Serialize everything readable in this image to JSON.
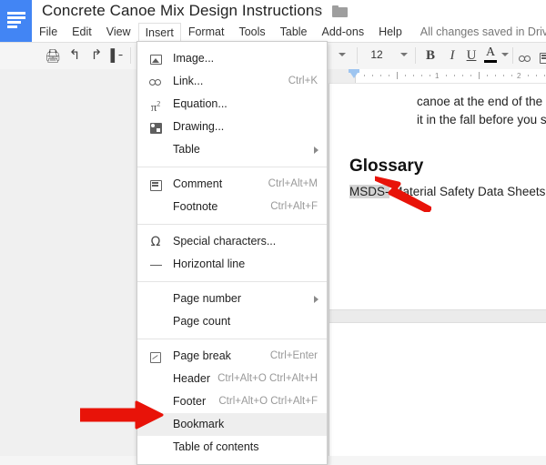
{
  "app": {
    "name": "Google Docs",
    "logo_icon": "docs-logo-icon",
    "accent_color": "#4285f4"
  },
  "header": {
    "doc_title": "Concrete Canoe Mix Design Instructions",
    "star_icon": "star-icon",
    "folder_icon": "folder-icon",
    "save_status": "All changes saved in Drive",
    "menus": [
      {
        "label": "File",
        "active": false
      },
      {
        "label": "Edit",
        "active": false
      },
      {
        "label": "View",
        "active": false
      },
      {
        "label": "Insert",
        "active": true
      },
      {
        "label": "Format",
        "active": false
      },
      {
        "label": "Tools",
        "active": false
      },
      {
        "label": "Table",
        "active": false
      },
      {
        "label": "Add-ons",
        "active": false
      },
      {
        "label": "Help",
        "active": false
      }
    ]
  },
  "toolbar": {
    "print_icon": "print-icon",
    "undo_icon": "undo-icon",
    "redo_icon": "redo-icon",
    "paint_format_icon": "paint-format-icon",
    "style_caret_icon": "chevron-down-icon",
    "font_size_value": "12",
    "font_size_caret_icon": "chevron-down-icon",
    "bold_label": "B",
    "italic_label": "I",
    "underline_label": "U",
    "text_color_label": "A",
    "text_color_swatch": "#000000",
    "text_color_caret_icon": "chevron-down-icon",
    "link_icon": "link-icon",
    "comment_icon": "comment-icon"
  },
  "ruler": {
    "marks": [
      "1",
      "2"
    ],
    "indent_marker_icon": "indent-marker-icon",
    "indent_marker_color": "#9ec5f0"
  },
  "insert_menu": {
    "groups": [
      {
        "items": [
          {
            "label": "Image...",
            "shortcut": "",
            "icon": "image-icon",
            "submenu": false,
            "hovered": false
          },
          {
            "label": "Link...",
            "shortcut": "Ctrl+K",
            "icon": "link-icon",
            "submenu": false,
            "hovered": false
          },
          {
            "label": "Equation...",
            "shortcut": "",
            "icon": "equation-icon",
            "submenu": false,
            "hovered": false
          },
          {
            "label": "Drawing...",
            "shortcut": "",
            "icon": "drawing-icon",
            "submenu": false,
            "hovered": false
          },
          {
            "label": "Table",
            "shortcut": "",
            "icon": "",
            "submenu": true,
            "hovered": false
          }
        ]
      },
      {
        "items": [
          {
            "label": "Comment",
            "shortcut": "Ctrl+Alt+M",
            "icon": "comment-icon",
            "submenu": false,
            "hovered": false
          },
          {
            "label": "Footnote",
            "shortcut": "Ctrl+Alt+F",
            "icon": "",
            "submenu": false,
            "hovered": false
          }
        ]
      },
      {
        "items": [
          {
            "label": "Special characters...",
            "shortcut": "",
            "icon": "omega-icon",
            "submenu": false,
            "hovered": false
          },
          {
            "label": "Horizontal line",
            "shortcut": "",
            "icon": "horizontal-line-icon",
            "submenu": false,
            "hovered": false
          }
        ]
      },
      {
        "items": [
          {
            "label": "Page number",
            "shortcut": "",
            "icon": "",
            "submenu": true,
            "hovered": false
          },
          {
            "label": "Page count",
            "shortcut": "",
            "icon": "",
            "submenu": false,
            "hovered": false
          }
        ]
      },
      {
        "items": [
          {
            "label": "Page break",
            "shortcut": "Ctrl+Enter",
            "icon": "page-break-icon",
            "submenu": false,
            "hovered": false
          },
          {
            "label": "Header",
            "shortcut": "Ctrl+Alt+O Ctrl+Alt+H",
            "icon": "",
            "submenu": false,
            "hovered": false
          },
          {
            "label": "Footer",
            "shortcut": "Ctrl+Alt+O Ctrl+Alt+F",
            "icon": "",
            "submenu": false,
            "hovered": false
          },
          {
            "label": "Bookmark",
            "shortcut": "",
            "icon": "",
            "submenu": false,
            "hovered": true
          },
          {
            "label": "Table of contents",
            "shortcut": "",
            "icon": "",
            "submenu": false,
            "hovered": false
          }
        ]
      }
    ]
  },
  "document": {
    "body_line_1": "canoe at the end of the",
    "body_line_2": "it in the fall before you s",
    "heading": "Glossary",
    "glossary_selected_text": "MSDS-",
    "glossary_rest_text": " Material Safety Data Sheets",
    "selection_highlight_color": "#d4d4d4"
  },
  "annotations": {
    "arrow_color": "#e81309",
    "arrow_to_glossary": "red-arrow-pointing-to-msds",
    "arrow_to_bookmark": "red-arrow-pointing-to-bookmark"
  }
}
